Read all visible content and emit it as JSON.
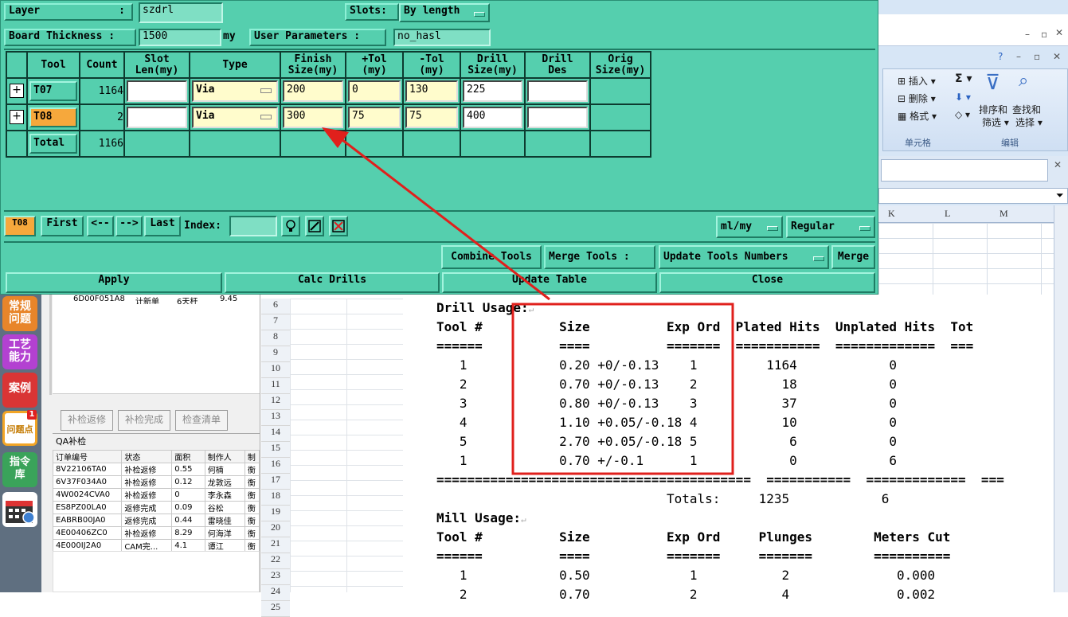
{
  "excel": {
    "columns": [
      "K",
      "L",
      "M"
    ],
    "ribbon": {
      "insert": "插入",
      "delete": "删除",
      "format": "格式",
      "sort_filter_1": "排序和",
      "sort_filter_2": "筛选",
      "find_select_1": "查找和",
      "find_select_2": "选择",
      "group_cells": "单元格",
      "group_edit": "编辑"
    }
  },
  "left_apps": [
    {
      "label": "常规\n问题",
      "color": "#e8852a"
    },
    {
      "label": "工艺\n能力",
      "color": "#b341d1"
    },
    {
      "label": "案例",
      "color": "#d93535"
    },
    {
      "label": "问题点",
      "color": "#f2a526",
      "badge": "1"
    },
    {
      "label": "指令\n库",
      "color": "#3aa35a"
    },
    {
      "label": "calendar",
      "color": "#3d7fd0"
    }
  ],
  "cn_panel": {
    "top_row": [
      "6D00F051A8",
      "计新单",
      "6天杆",
      "9.45"
    ],
    "buttons": [
      "补检返修",
      "补检完成",
      "检查清单"
    ],
    "qa_title": "QA补检",
    "qa_headers": [
      "订单编号",
      "状态",
      "面积",
      "制作人",
      "制"
    ],
    "qa_rows": [
      [
        "8V22106TA0",
        "补检返修",
        "0.55",
        "何楠",
        "衡"
      ],
      [
        "6V37F034A0",
        "补检返修",
        "0.12",
        "龙敦远",
        "衡"
      ],
      [
        "4W0024CVA0",
        "补检返修",
        "0",
        "李永森",
        "衡"
      ],
      [
        "ES8PZ00LA0",
        "返修完成",
        "0.09",
        "谷松",
        "衡"
      ],
      [
        "EABRB00JA0",
        "返修完成",
        "0.44",
        "雷晓佳",
        "衡"
      ],
      [
        "4E00406ZC0",
        "补检返修",
        "8.29",
        "何海洋",
        "衡"
      ],
      [
        "4E000IJ2A0",
        "CAM完...",
        "4.1",
        "谭江",
        "衡"
      ]
    ]
  },
  "row_numbers": [
    "6",
    "7",
    "8",
    "9",
    "10",
    "11",
    "12",
    "13",
    "14",
    "15",
    "16",
    "17",
    "18",
    "19",
    "20",
    "21",
    "22",
    "23",
    "24",
    "25"
  ],
  "doc": {
    "drill_title": "Drill Usage:",
    "drill_header": "Tool #          Size          Exp Ord  Plated Hits  Unplated Hits  Tot",
    "drill_rule": "======          ====          =======  ===========  =============  ===",
    "drill_rows": [
      "   1            0.20 +0/-0.13    1         1164            0",
      "   2            0.70 +0/-0.13    2           18            0",
      "   3            0.80 +0/-0.13    3           37            0",
      "   4            1.10 +0.05/-0.18 4           10            0",
      "   5            2.70 +0.05/-0.18 5            6            0",
      "   1            0.70 +/-0.1      1            0            6"
    ],
    "drill_rule2": "=========================================  ===========  =============  ===",
    "totals": "                              Totals:     1235            6",
    "mill_title": "Mill Usage:",
    "mill_header": "Tool #          Size          Exp Ord     Plunges        Meters Cut",
    "mill_rule": "======          ====          =======     =======        ==========",
    "mill_rows": [
      "   1            0.50             1           2              0.000",
      "   2            0.70             2           4              0.002"
    ]
  },
  "cam": {
    "layer_label": "Layer",
    "layer_value": "szdrl",
    "slots_label": "Slots:",
    "slots_value": "By length",
    "thickness_label": "Board Thickness :",
    "thickness_value": "1500",
    "thickness_unit": "my",
    "user_params_label": "User Parameters :",
    "user_params_value": "no_hasl",
    "headers": [
      "Tool",
      "Count",
      "Slot\nLen(my)",
      "Type",
      "Finish\nSize(my)",
      "+Tol\n(my)",
      "-Tol\n(my)",
      "Drill\nSize(my)",
      "Drill\nDes",
      "Orig\nSize(my)"
    ],
    "rows": [
      {
        "tool": "T07",
        "count": "1164",
        "type": "Via",
        "finish": "200",
        "ptol": "0",
        "mtol": "130",
        "drill": "225",
        "selected": false
      },
      {
        "tool": "T08",
        "count": "2",
        "type": "Via",
        "finish": "300",
        "ptol": "75",
        "mtol": "75",
        "drill": "400",
        "selected": true
      }
    ],
    "total_label": "Total",
    "total_count": "1166",
    "nav": {
      "current": "T08",
      "first": "First",
      "prev": "<--",
      "next": "-->",
      "last": "Last",
      "index_label": "Index:",
      "units": "ml/my",
      "mode": "Regular"
    },
    "combine_tools": "Combine Tools",
    "merge_tools_label": "Merge Tools :",
    "merge_tools_value": "Update Tools Numbers",
    "merge_btn": "Merge",
    "apply": "Apply",
    "calc_drills": "Calc Drills",
    "update_table": "Update Table",
    "close": "Close",
    "accent": "#55cfae",
    "selected_color": "#f6a83c",
    "annotation_color": "#e0201c"
  }
}
